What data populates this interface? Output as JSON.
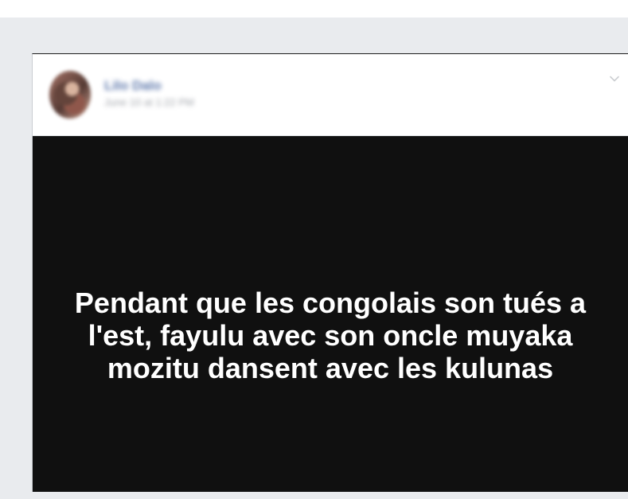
{
  "post": {
    "author_name": "Lilo Dalo",
    "timestamp": "June 10 at 1:22 PM",
    "body_text": "Pendant que les congolais son tués a l'est, fayulu avec son oncle muyaka mozitu dansent avec les kulunas"
  },
  "icons": {
    "menu": "chevron-down-icon"
  }
}
